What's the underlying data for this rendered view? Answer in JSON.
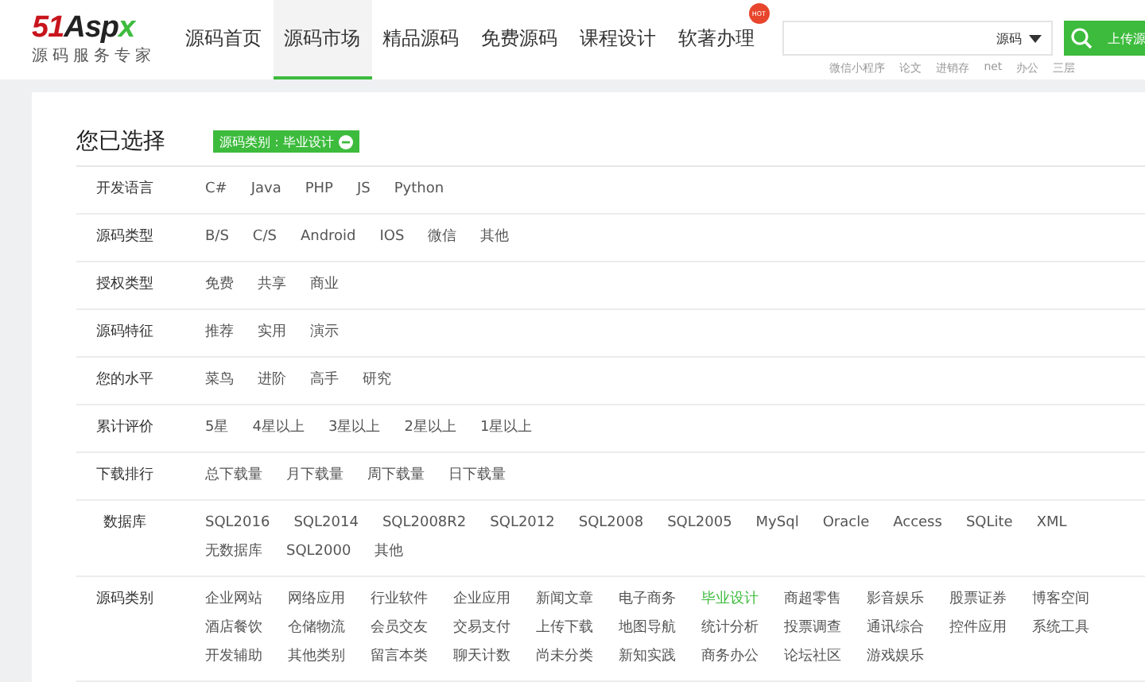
{
  "header": {
    "logo": "51Aspx",
    "slogan": "源码服务专家",
    "nav": [
      {
        "label": "源码首页",
        "selected": false
      },
      {
        "label": "源码市场",
        "selected": true
      },
      {
        "label": "精品源码",
        "selected": false
      },
      {
        "label": "免费源码",
        "selected": false
      },
      {
        "label": "课程设计",
        "selected": false
      },
      {
        "label": "软著办理",
        "selected": false,
        "badge": "HOT"
      }
    ],
    "search": {
      "scope": "源码",
      "hot_links": [
        "微信小程序",
        "论文",
        "进销存",
        "net",
        "办公",
        "三层"
      ]
    },
    "upload_button": "上传源"
  },
  "selection": {
    "title": "您已选择",
    "tags": [
      "源码类别：毕业设计"
    ]
  },
  "filters": [
    {
      "label": "开发语言",
      "kind": "inline",
      "items": [
        {
          "text": "C#",
          "selected": false
        },
        {
          "text": "Java",
          "selected": false
        },
        {
          "text": "PHP",
          "selected": false
        },
        {
          "text": "JS",
          "selected": false
        },
        {
          "text": "Python",
          "selected": false
        }
      ]
    },
    {
      "label": "源码类型",
      "kind": "inline",
      "items": [
        {
          "text": "B/S",
          "selected": false
        },
        {
          "text": "C/S",
          "selected": false
        },
        {
          "text": "Android",
          "selected": false
        },
        {
          "text": "IOS",
          "selected": false
        },
        {
          "text": "微信",
          "selected": false
        },
        {
          "text": "其他",
          "selected": false
        }
      ]
    },
    {
      "label": "授权类型",
      "kind": "inline",
      "items": [
        {
          "text": "免费",
          "selected": false
        },
        {
          "text": "共享",
          "selected": false
        },
        {
          "text": "商业",
          "selected": false
        }
      ]
    },
    {
      "label": "源码特征",
      "kind": "inline",
      "items": [
        {
          "text": "推荐",
          "selected": false
        },
        {
          "text": "实用",
          "selected": false
        },
        {
          "text": "演示",
          "selected": false
        }
      ]
    },
    {
      "label": "您的水平",
      "kind": "inline",
      "items": [
        {
          "text": "菜鸟",
          "selected": false
        },
        {
          "text": "进阶",
          "selected": false
        },
        {
          "text": "高手",
          "selected": false
        },
        {
          "text": "研究",
          "selected": false
        }
      ]
    },
    {
      "label": "累计评价",
      "kind": "inline",
      "items": [
        {
          "text": "5星",
          "selected": false
        },
        {
          "text": "4星以上",
          "selected": false
        },
        {
          "text": "3星以上",
          "selected": false
        },
        {
          "text": "2星以上",
          "selected": false
        },
        {
          "text": "1星以上",
          "selected": false
        }
      ]
    },
    {
      "label": "下载排行",
      "kind": "inline",
      "items": [
        {
          "text": "总下载量",
          "selected": false
        },
        {
          "text": "月下载量",
          "selected": false
        },
        {
          "text": "周下载量",
          "selected": false
        },
        {
          "text": "日下载量",
          "selected": false
        }
      ]
    },
    {
      "label": "数据库",
      "kind": "inline",
      "items": [
        {
          "text": "SQL2016",
          "selected": false
        },
        {
          "text": "SQL2014",
          "selected": false
        },
        {
          "text": "SQL2008R2",
          "selected": false
        },
        {
          "text": "SQL2012",
          "selected": false
        },
        {
          "text": "SQL2008",
          "selected": false
        },
        {
          "text": "SQL2005",
          "selected": false
        },
        {
          "text": "MySql",
          "selected": false
        },
        {
          "text": "Oracle",
          "selected": false
        },
        {
          "text": "Access",
          "selected": false
        },
        {
          "text": "SQLite",
          "selected": false
        },
        {
          "text": "XML",
          "selected": false
        },
        {
          "text": "无数据库",
          "selected": false
        },
        {
          "text": "SQL2000",
          "selected": false
        },
        {
          "text": "其他",
          "selected": false
        }
      ]
    },
    {
      "label": "源码类别",
      "kind": "grid",
      "items": [
        {
          "text": "企业网站",
          "selected": false
        },
        {
          "text": "网络应用",
          "selected": false
        },
        {
          "text": "行业软件",
          "selected": false
        },
        {
          "text": "企业应用",
          "selected": false
        },
        {
          "text": "新闻文章",
          "selected": false
        },
        {
          "text": "电子商务",
          "selected": false
        },
        {
          "text": "毕业设计",
          "selected": true
        },
        {
          "text": "商超零售",
          "selected": false
        },
        {
          "text": "影音娱乐",
          "selected": false
        },
        {
          "text": "股票证券",
          "selected": false
        },
        {
          "text": "博客空间",
          "selected": false
        },
        {
          "text": "酒店餐饮",
          "selected": false
        },
        {
          "text": "仓储物流",
          "selected": false
        },
        {
          "text": "会员交友",
          "selected": false
        },
        {
          "text": "交易支付",
          "selected": false
        },
        {
          "text": "上传下载",
          "selected": false
        },
        {
          "text": "地图导航",
          "selected": false
        },
        {
          "text": "统计分析",
          "selected": false
        },
        {
          "text": "投票调查",
          "selected": false
        },
        {
          "text": "通讯综合",
          "selected": false
        },
        {
          "text": "控件应用",
          "selected": false
        },
        {
          "text": "系统工具",
          "selected": false
        },
        {
          "text": "开发辅助",
          "selected": false
        },
        {
          "text": "其他类别",
          "selected": false
        },
        {
          "text": "留言本类",
          "selected": false
        },
        {
          "text": "聊天计数",
          "selected": false
        },
        {
          "text": "尚未分类",
          "selected": false
        },
        {
          "text": "新知实践",
          "selected": false
        },
        {
          "text": "商务办公",
          "selected": false
        },
        {
          "text": "论坛社区",
          "selected": false
        },
        {
          "text": "游戏娱乐",
          "selected": false
        }
      ]
    }
  ]
}
